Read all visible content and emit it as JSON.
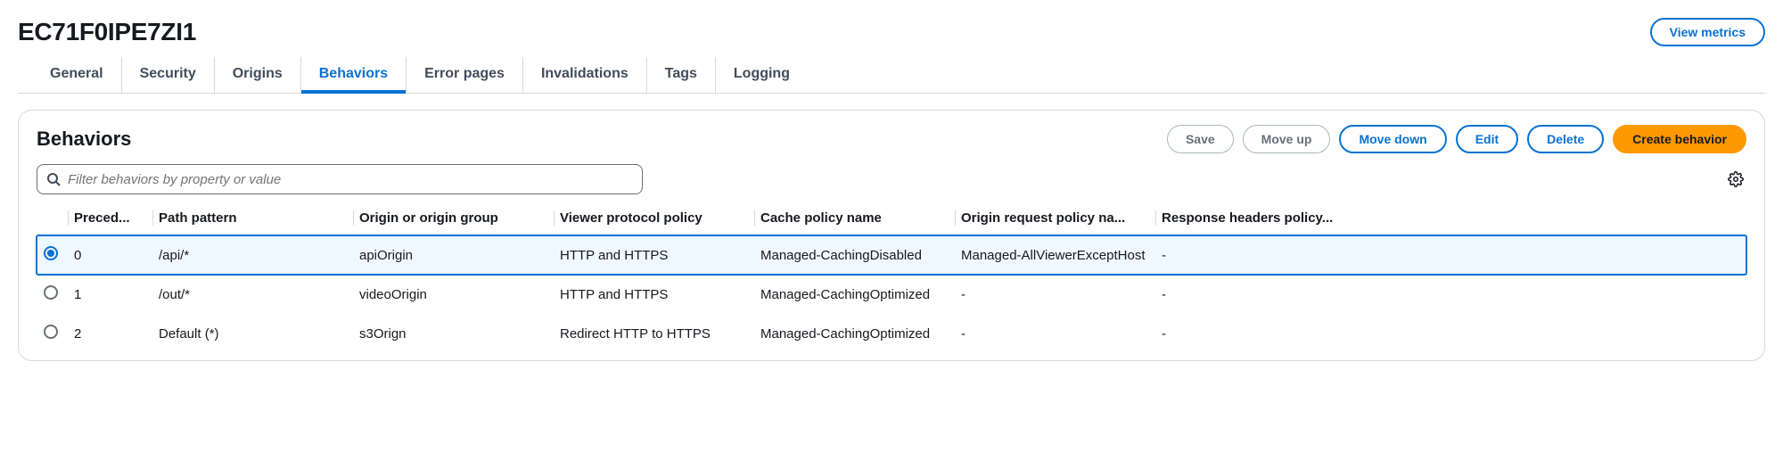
{
  "header": {
    "title": "EC71F0IPE7ZI1",
    "view_metrics": "View metrics"
  },
  "tabs": {
    "items": [
      {
        "label": "General"
      },
      {
        "label": "Security"
      },
      {
        "label": "Origins"
      },
      {
        "label": "Behaviors"
      },
      {
        "label": "Error pages"
      },
      {
        "label": "Invalidations"
      },
      {
        "label": "Tags"
      },
      {
        "label": "Logging"
      }
    ],
    "active_index": 3
  },
  "panel": {
    "title": "Behaviors",
    "actions": {
      "save": "Save",
      "move_up": "Move up",
      "move_down": "Move down",
      "edit": "Edit",
      "delete": "Delete",
      "create": "Create behavior"
    },
    "filter": {
      "placeholder": "Filter behaviors by property or value"
    },
    "columns": {
      "precedence": "Preced...",
      "path_pattern": "Path pattern",
      "origin": "Origin or origin group",
      "viewer_protocol": "Viewer protocol policy",
      "cache_policy": "Cache policy name",
      "origin_request_policy": "Origin request policy na...",
      "response_headers_policy": "Response headers policy..."
    },
    "rows": [
      {
        "selected": true,
        "precedence": "0",
        "path_pattern": "/api/*",
        "origin": "apiOrigin",
        "viewer_protocol": "HTTP and HTTPS",
        "cache_policy": "Managed-CachingDisabled",
        "origin_request_policy": "Managed-AllViewerExceptHost",
        "response_headers_policy": "-"
      },
      {
        "selected": false,
        "precedence": "1",
        "path_pattern": "/out/*",
        "origin": "videoOrigin",
        "viewer_protocol": "HTTP and HTTPS",
        "cache_policy": "Managed-CachingOptimized",
        "origin_request_policy": "-",
        "response_headers_policy": "-"
      },
      {
        "selected": false,
        "precedence": "2",
        "path_pattern": "Default (*)",
        "origin": "s3Orign",
        "viewer_protocol": "Redirect HTTP to HTTPS",
        "cache_policy": "Managed-CachingOptimized",
        "origin_request_policy": "-",
        "response_headers_policy": "-"
      }
    ]
  }
}
